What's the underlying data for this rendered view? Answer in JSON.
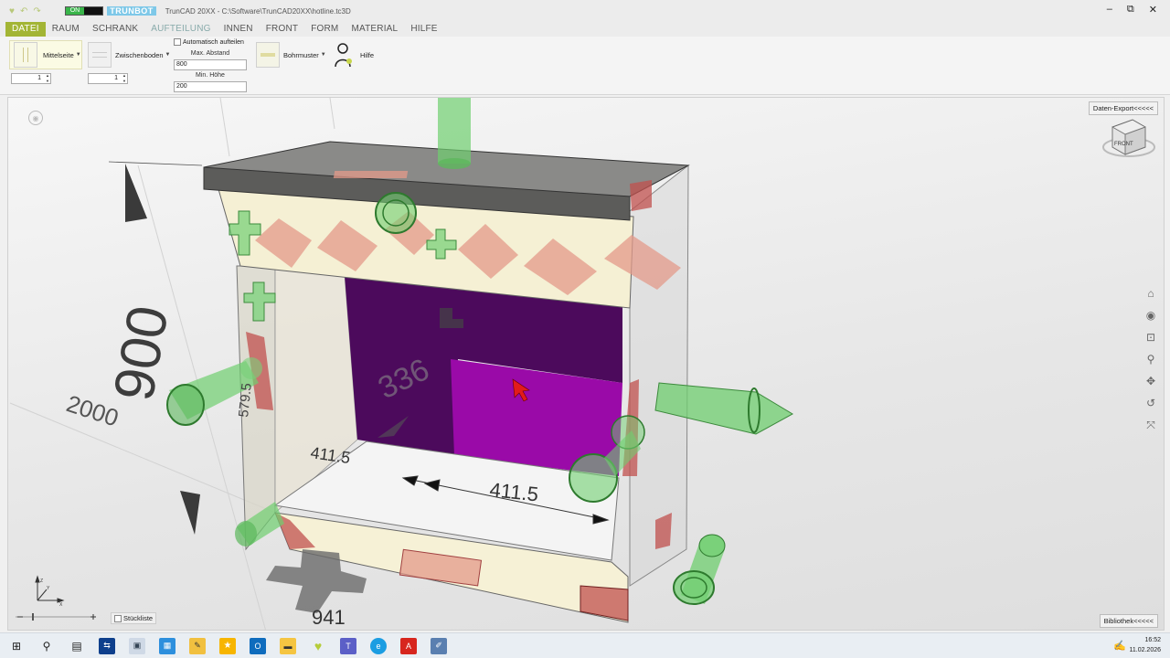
{
  "titlebar": {
    "on_label": "ON",
    "brand": "TRUNBOT",
    "title": "TrunCAD 20XX - C:\\Software\\TrunCAD20XX\\hotline.tc3D",
    "minimize": "–",
    "restore": "⧉",
    "close": "✕"
  },
  "menu": {
    "tabs": [
      "DATEI",
      "RAUM",
      "SCHRANK",
      "AUFTEILUNG",
      "INNEN",
      "FRONT",
      "FORM",
      "MATERIAL",
      "HILFE"
    ]
  },
  "ribbon": {
    "mittelseite": "Mittelseite",
    "mittelseite_count": "1",
    "zwischenboden": "Zwischenboden",
    "zwischenboden_count": "1",
    "auto_label": "Automatisch aufteilen",
    "max_abstand_label": "Max. Abstand",
    "max_abstand_value": "800",
    "min_hoehe_label": "Min. Höhe",
    "min_hoehe_value": "200",
    "bohrmuster": "Bohrmuster",
    "hilfe": "Hilfe"
  },
  "viewport": {
    "export_label": "Daten-Export<<<<<",
    "library_label": "Bibliothek<<<<<",
    "stueckliste": "Stückliste",
    "viewcube_face": "FRONT",
    "dimensions": {
      "height": "900",
      "width": "2000",
      "depth_small": "579.5",
      "inner_left": "411.5",
      "inner_bottom": "411.5",
      "inner_height": "336",
      "bottom_partial": "941"
    }
  },
  "taskbar": {
    "time": "16:52",
    "date": "11.02.2026",
    "icons": [
      "windows-start-icon",
      "search-icon",
      "task-view-icon",
      "teamviewer-icon",
      "app-icon",
      "calculator-icon",
      "app2-icon",
      "star-icon",
      "outlook-icon",
      "explorer-icon",
      "truncad-icon",
      "teams-icon",
      "edge-icon",
      "acrobat-icon",
      "truncad2-icon"
    ]
  },
  "colors": {
    "accent": "#a3b535",
    "on_green": "#39b54a",
    "purple_panel": "#5a0a6a",
    "magenta_panel": "#9a0aa8",
    "green_gizmo": "#4caf50",
    "red_marker": "#c0504d"
  }
}
